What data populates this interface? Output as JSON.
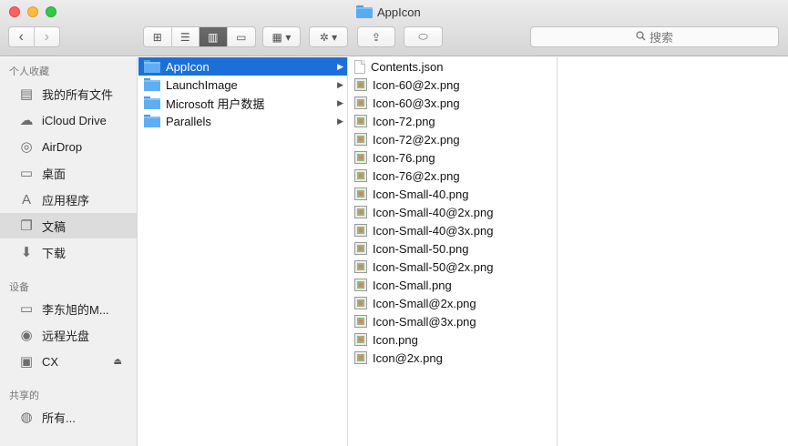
{
  "window": {
    "title": "AppIcon"
  },
  "toolbar": {
    "view_icons": "⊞",
    "view_list": "☰",
    "view_columns": "▥",
    "view_cover": "▭",
    "group_label": "▦ ▾",
    "action_label": "✲ ▾",
    "share_label": "⇪",
    "tag_label": "⬭",
    "search_placeholder": "搜索"
  },
  "sidebar": {
    "favorites_header": "个人收藏",
    "favorites": [
      {
        "label": "我的所有文件",
        "icon": "all-files-icon"
      },
      {
        "label": "iCloud Drive",
        "icon": "cloud-icon"
      },
      {
        "label": "AirDrop",
        "icon": "airdrop-icon"
      },
      {
        "label": "桌面",
        "icon": "desktop-icon"
      },
      {
        "label": "应用程序",
        "icon": "applications-icon"
      },
      {
        "label": "文稿",
        "icon": "documents-icon"
      },
      {
        "label": "下载",
        "icon": "downloads-icon"
      }
    ],
    "devices_header": "设备",
    "devices": [
      {
        "label": "李东旭的M...",
        "icon": "laptop-icon"
      },
      {
        "label": "远程光盘",
        "icon": "disc-icon"
      },
      {
        "label": "CX",
        "icon": "drive-icon"
      }
    ],
    "shared_header": "共享的",
    "shared": [
      {
        "label": "所有...",
        "icon": "network-icon"
      }
    ]
  },
  "column1": {
    "items": [
      {
        "label": "AppIcon",
        "selected": true
      },
      {
        "label": "LaunchImage"
      },
      {
        "label": "Microsoft 用户数据"
      },
      {
        "label": "Parallels"
      }
    ]
  },
  "column2": {
    "items": [
      {
        "label": "Contents.json",
        "type": "json"
      },
      {
        "label": "Icon-60@2x.png",
        "type": "png"
      },
      {
        "label": "Icon-60@3x.png",
        "type": "png"
      },
      {
        "label": "Icon-72.png",
        "type": "png"
      },
      {
        "label": "Icon-72@2x.png",
        "type": "png"
      },
      {
        "label": "Icon-76.png",
        "type": "png"
      },
      {
        "label": "Icon-76@2x.png",
        "type": "png"
      },
      {
        "label": "Icon-Small-40.png",
        "type": "png"
      },
      {
        "label": "Icon-Small-40@2x.png",
        "type": "png"
      },
      {
        "label": "Icon-Small-40@3x.png",
        "type": "png"
      },
      {
        "label": "Icon-Small-50.png",
        "type": "png"
      },
      {
        "label": "Icon-Small-50@2x.png",
        "type": "png"
      },
      {
        "label": "Icon-Small.png",
        "type": "png"
      },
      {
        "label": "Icon-Small@2x.png",
        "type": "png"
      },
      {
        "label": "Icon-Small@3x.png",
        "type": "png"
      },
      {
        "label": "Icon.png",
        "type": "png"
      },
      {
        "label": "Icon@2x.png",
        "type": "png"
      }
    ]
  },
  "colors": {
    "selection": "#1c6fd8",
    "sidebar_bg": "#f0f0f1"
  }
}
